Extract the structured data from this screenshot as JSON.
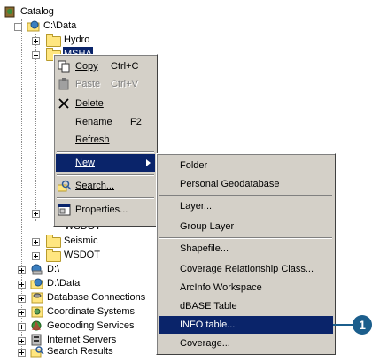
{
  "tree": {
    "root": "Catalog",
    "c_data": "C:\\Data",
    "hydro": "Hydro",
    "msha": "MSHA",
    "wsdot_partial": "WSDOT",
    "seismic": "Seismic",
    "wsdot": "WSDOT",
    "d_root": "D:\\",
    "d_data": "D:\\Data",
    "db_conn": "Database Connections",
    "coord_sys": "Coordinate Systems",
    "geocoding": "Geocoding Services",
    "internet": "Internet Servers",
    "search_results": "Search Results"
  },
  "context_menu": {
    "copy": "Copy",
    "copy_sc": "Ctrl+C",
    "paste": "Paste",
    "paste_sc": "Ctrl+V",
    "delete": "Delete",
    "rename": "Rename",
    "rename_sc": "F2",
    "refresh": "Refresh",
    "new": "New",
    "search": "Search...",
    "properties": "Properties..."
  },
  "new_submenu": {
    "folder": "Folder",
    "personal_geodatabase": "Personal Geodatabase",
    "layer": "Layer...",
    "group_layer": "Group Layer",
    "shapefile": "Shapefile...",
    "coverage_relationship": "Coverage Relationship Class...",
    "arcinfo_workspace": "ArcInfo Workspace",
    "dbase_table": "dBASE Table",
    "info_table": "INFO table...",
    "coverage": "Coverage..."
  },
  "callout": {
    "number": "1",
    "color": "#1b5e8c"
  },
  "colors": {
    "highlight": "#0a246a",
    "menu_bg": "#d4d0c8",
    "folder": "#ffe680"
  }
}
